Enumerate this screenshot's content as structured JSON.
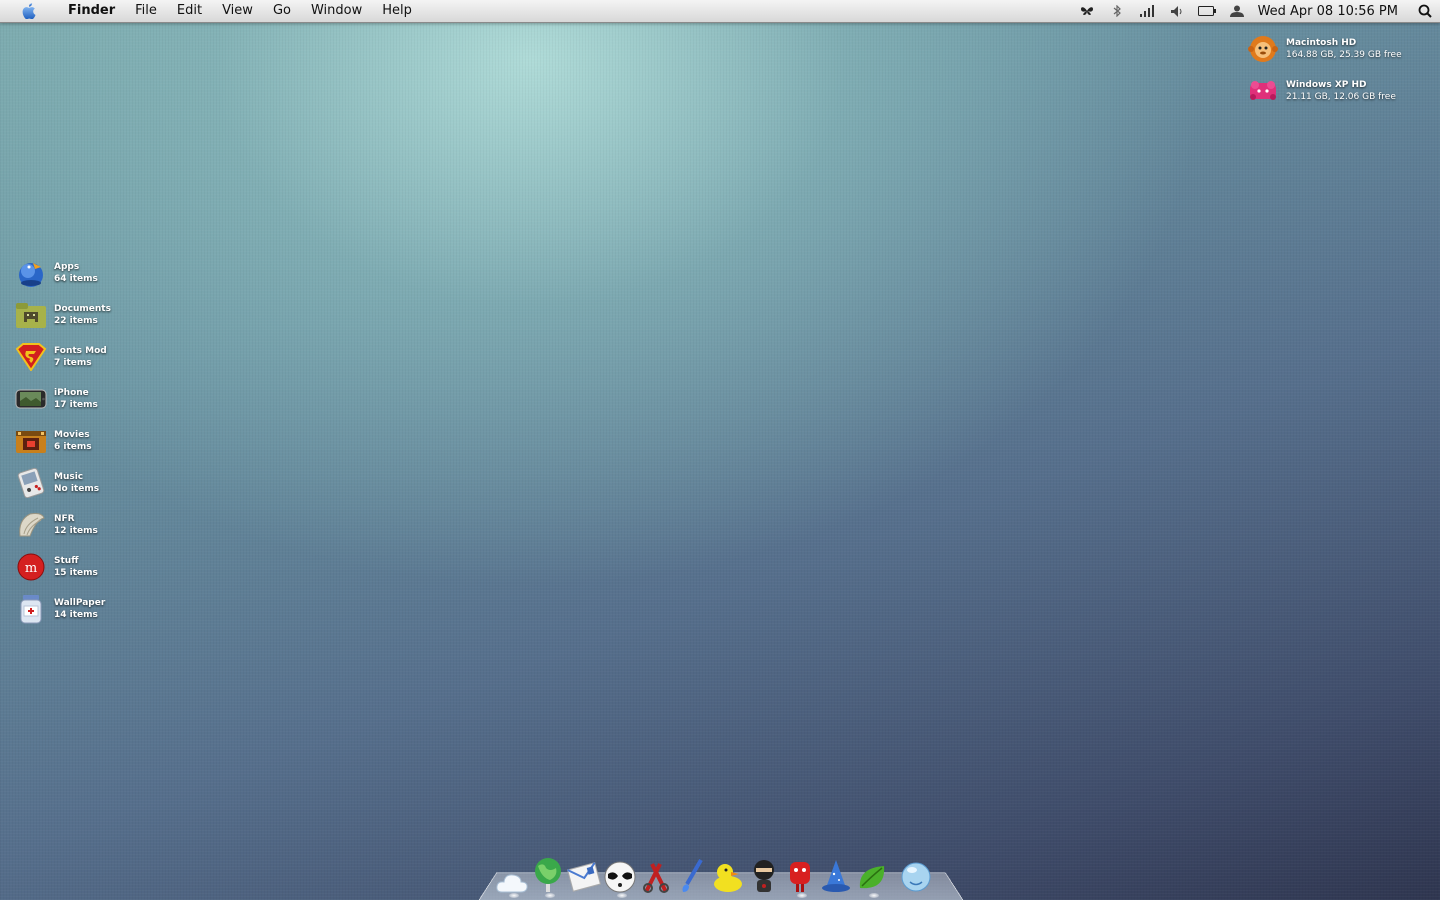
{
  "menubar": {
    "app_name": "Finder",
    "menus": [
      "File",
      "Edit",
      "View",
      "Go",
      "Window",
      "Help"
    ],
    "status_icons": [
      "butterfly-icon",
      "bluetooth-icon",
      "signal-bars-icon",
      "volume-icon",
      "battery-icon",
      "user-icon"
    ],
    "clock": "Wed Apr 08  10:56 PM",
    "spotlight_icon": "spotlight-search-icon"
  },
  "drives": [
    {
      "name": "Macintosh HD",
      "info": "164.88 GB, 25.39 GB free",
      "icon": "monkey-drive-icon"
    },
    {
      "name": "Windows XP HD",
      "info": "21.11 GB, 12.06 GB free",
      "icon": "pink-drive-icon"
    }
  ],
  "folders": [
    {
      "name": "Apps",
      "count": "64 items",
      "icon": "bird-globe-icon"
    },
    {
      "name": "Documents",
      "count": "22 items",
      "icon": "space-invader-folder-icon"
    },
    {
      "name": "Fonts Mod",
      "count": "7 items",
      "icon": "superman-shield-icon"
    },
    {
      "name": "iPhone",
      "count": "17 items",
      "icon": "iphone-icon"
    },
    {
      "name": "Movies",
      "count": "6 items",
      "icon": "film-reel-icon"
    },
    {
      "name": "Music",
      "count": "No items",
      "icon": "gameboy-music-icon"
    },
    {
      "name": "NFR",
      "count": "12 items",
      "icon": "shell-icon"
    },
    {
      "name": "Stuff",
      "count": "15 items",
      "icon": "red-badge-icon"
    },
    {
      "name": "WallPaper",
      "count": "14 items",
      "icon": "jar-icon"
    }
  ],
  "dock": {
    "items": [
      "cloud-icon",
      "globe-balloon-icon",
      "mail-stamp-icon",
      "panda-mask-icon",
      "scissors-icon",
      "paintbrush-icon",
      "rubber-duck-icon",
      "ninja-icon",
      "red-robot-icon",
      "wizard-hat-icon",
      "leaf-icon",
      "trash-bubble-icon"
    ]
  }
}
